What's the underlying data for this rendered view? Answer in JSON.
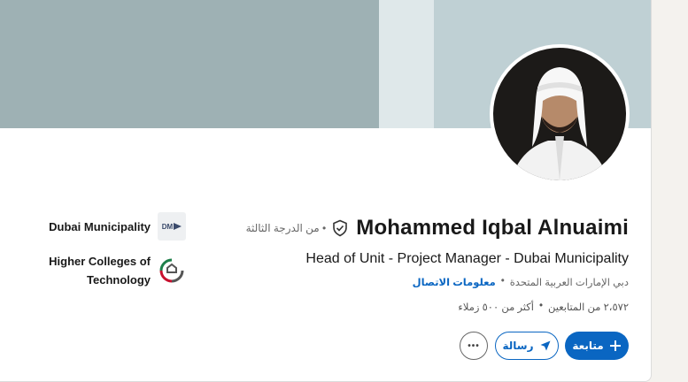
{
  "profile": {
    "name": "Mohammed Iqbal Alnuaimi",
    "degree": "• من الدرجة الثالثة",
    "headline": "Head of Unit - Project Manager - Dubai Municipality",
    "location": "دبي الإمارات العربية المتحدة",
    "separator": "•",
    "contact_info": "معلومات الاتصال",
    "followers": "٢،٥٧٢ من المتابعين",
    "connections": "أكثر من ٥٠٠ زملاء"
  },
  "actions": {
    "follow": "متابعة",
    "message": "رسالة",
    "more": "•••"
  },
  "organizations": [
    {
      "name": "Dubai Municipality",
      "logo_text": "DM"
    },
    {
      "name": "Higher Colleges of Technology"
    }
  ],
  "colors": {
    "primary": "#0a66c2",
    "cover_dark": "#9eb1b4",
    "cover_light": "#bfd0d4"
  }
}
